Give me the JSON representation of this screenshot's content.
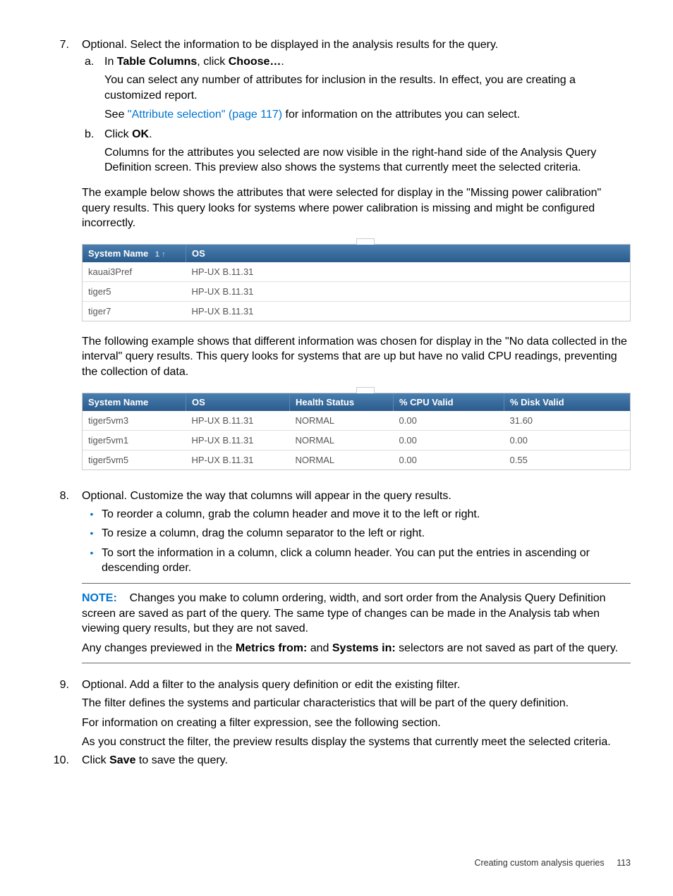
{
  "step7": {
    "num": "7.",
    "intro": "Optional. Select the information to be displayed in the analysis results for the query.",
    "a": {
      "let": "a.",
      "line1_a": "In ",
      "line1_b": "Table Columns",
      "line1_c": ", click ",
      "line1_d": "Choose…",
      "line1_e": ".",
      "p1": "You can select any number of attributes for inclusion in the results. In effect, you are creating a customized report.",
      "p2_a": "See ",
      "p2_link": "\"Attribute selection\" (page 117)",
      "p2_b": " for information on the attributes you can select."
    },
    "b": {
      "let": "b.",
      "line1_a": "Click ",
      "line1_b": "OK",
      "line1_c": ".",
      "p1": "Columns for the attributes you selected are now visible in the right-hand side of the Analysis Query Definition screen. This preview also shows the systems that currently meet the selected criteria."
    },
    "below1": "The example below shows the attributes that were selected for display in the \"Missing power calibration\" query results. This query looks for systems where power calibration is missing and might be configured incorrectly."
  },
  "table1": {
    "headers": {
      "c1": "System Name",
      "sort": "1 ↑",
      "c2": "OS"
    },
    "rows": [
      {
        "c1": "kauai3Pref",
        "c2": "HP-UX B.11.31"
      },
      {
        "c1": "tiger5",
        "c2": "HP-UX B.11.31"
      },
      {
        "c1": "tiger7",
        "c2": "HP-UX B.11.31"
      }
    ]
  },
  "between": "The following example shows that different information was chosen for display in the \"No data collected in the interval\" query results. This query looks for systems that are up but have no valid CPU readings, preventing the collection of data.",
  "table2": {
    "headers": {
      "c1": "System Name",
      "c2": "OS",
      "c3": "Health Status",
      "c4": "% CPU Valid",
      "c5": "% Disk Valid"
    },
    "rows": [
      {
        "c1": "tiger5vm3",
        "c2": "HP-UX B.11.31",
        "c3": "NORMAL",
        "c4": "0.00",
        "c5": "31.60"
      },
      {
        "c1": "tiger5vm1",
        "c2": "HP-UX B.11.31",
        "c3": "NORMAL",
        "c4": "0.00",
        "c5": "0.00"
      },
      {
        "c1": "tiger5vm5",
        "c2": "HP-UX B.11.31",
        "c3": "NORMAL",
        "c4": "0.00",
        "c5": "0.55"
      }
    ]
  },
  "step8": {
    "num": "8.",
    "intro": "Optional. Customize the way that columns will appear in the query results.",
    "b1": "To reorder a column, grab the column header and move it to the left or right.",
    "b2": "To resize a column, drag the column separator to the left or right.",
    "b3": "To sort the information in a column, click a column header. You can put the entries in ascending or descending order.",
    "note_label": "NOTE:",
    "note_p1": "Changes you make to column ordering, width, and sort order from the Analysis Query Definition screen are saved as part of the query. The same type of changes can be made in the Analysis tab when viewing query results, but they are not saved.",
    "note_p2_a": "Any changes previewed in the ",
    "note_p2_b": "Metrics from:",
    "note_p2_c": " and ",
    "note_p2_d": "Systems in:",
    "note_p2_e": " selectors are not saved as part of the query."
  },
  "step9": {
    "num": "9.",
    "intro": "Optional. Add a filter to the analysis query definition or edit the existing filter.",
    "p1": "The filter defines the systems and particular characteristics that will be part of the query definition.",
    "p2": "For information on creating a filter expression, see the following section.",
    "p3": "As you construct the filter, the preview results display the systems that currently meet the selected criteria."
  },
  "step10": {
    "num": "10.",
    "a": "Click ",
    "b": "Save",
    "c": " to save the query."
  },
  "footer": {
    "text": "Creating custom analysis queries",
    "page": "113"
  }
}
